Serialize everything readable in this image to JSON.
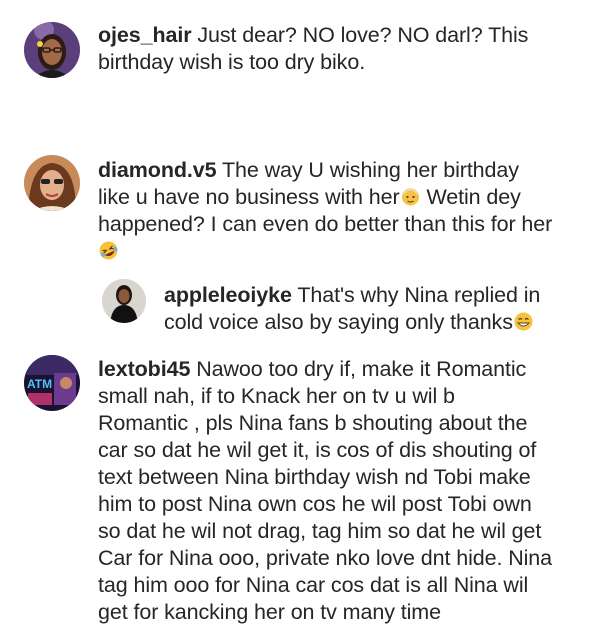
{
  "comments": [
    {
      "username": "ojes_hair",
      "lines": [
        "Just dear? NO love? NO darl? This",
        "birthday wish is too dry biko."
      ],
      "avatar_icon": "woman-glasses-avatar"
    },
    {
      "username": "diamond.v5",
      "lines": [
        "The way U wishing her birthday",
        "like u have no business with her",
        "Wetin dey",
        "happened? I can even do better than this for her"
      ],
      "emoji_1": "older-woman-emoji",
      "emoji_2": "rofl-emoji",
      "avatar_icon": "woman-sunglasses-avatar"
    },
    {
      "username": "appleleoiyke",
      "lines": [
        "That's why Nina replied in",
        "cold voice also by saying only thanks"
      ],
      "emoji_1": "grinning-smile-emoji",
      "avatar_icon": "woman-black-dress-avatar",
      "is_reply": true
    },
    {
      "username": "lextobi45",
      "lines": [
        "Nawoo too dry if, make it Romantic",
        "small nah, if to Knack her on tv u wil b",
        "Romantic , pls Nina fans b shouting about the",
        "car so dat he wil get it, is cos of dis shouting of",
        "text between Nina birthday wish nd Tobi make",
        "him to post Nina own cos he wil post Tobi own",
        "so dat he wil not drag, tag him so dat he wil get",
        "Car for Nina ooo, private nko love dnt hide. Nina",
        "tag him ooo for Nina car cos dat is all Nina wil",
        "get for kancking her on tv many time"
      ],
      "avatar_icon": "atm-logo-avatar",
      "avatar_text": "ATM"
    }
  ],
  "colors": {
    "text": "#262626",
    "background": "#ffffff"
  }
}
